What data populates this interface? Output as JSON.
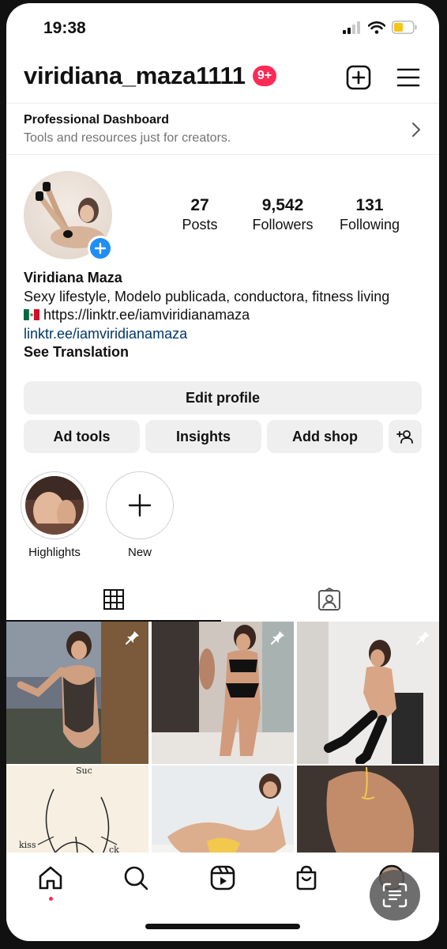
{
  "status_bar": {
    "time": "19:38"
  },
  "header": {
    "username": "viridiana_maza1111",
    "notification_badge": "9+"
  },
  "dashboard": {
    "title": "Professional Dashboard",
    "subtitle": "Tools and resources just for creators."
  },
  "stats": [
    {
      "value": "27",
      "label": "Posts"
    },
    {
      "value": "9,542",
      "label": "Followers"
    },
    {
      "value": "131",
      "label": "Following"
    }
  ],
  "bio": {
    "name": "Viridiana Maza",
    "description": "Sexy lifestyle, Modelo publicada, conductora, fitness living",
    "flag_link": "https://linktr.ee/iamviridianamaza",
    "link": "linktr.ee/iamviridianamaza",
    "see_translation": "See Translation"
  },
  "buttons": {
    "edit_profile": "Edit profile",
    "ad_tools": "Ad tools",
    "insights": "Insights",
    "add_shop": "Add shop"
  },
  "highlights": [
    {
      "label": "Highlights"
    },
    {
      "label": "New"
    }
  ],
  "grid_posts": [
    {
      "pinned": true
    },
    {
      "pinned": true
    },
    {
      "pinned": true
    },
    {
      "pinned": false,
      "sketch_text": [
        "Suc",
        "kiss",
        "ck"
      ]
    },
    {
      "pinned": false
    },
    {
      "pinned": false
    }
  ],
  "colors": {
    "badge": "#ff2a55",
    "link": "#00376b",
    "accent_blue": "#1f8ef5",
    "button_bg": "#efefef"
  }
}
